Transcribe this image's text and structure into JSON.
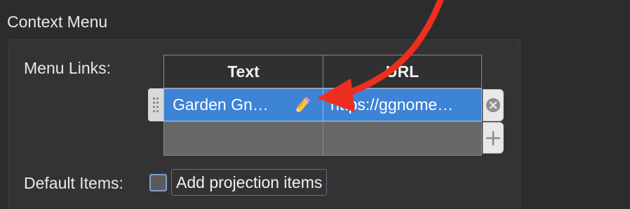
{
  "section": {
    "title": "Context Menu"
  },
  "menu_links": {
    "label": "Menu Links:",
    "columns": [
      "Text",
      "URL"
    ],
    "rows": [
      {
        "text": "Garden Gn…",
        "url": "https://ggnome…",
        "selected": true,
        "editable_icon": "pencil-icon"
      }
    ],
    "remove_icon": "circle-x-icon",
    "add_icon": "plus-icon"
  },
  "default_items": {
    "label": "Default Items:",
    "checkbox_label": "Add projection items",
    "checked": false
  },
  "annotation": {
    "icon": "red-arrow-icon",
    "color": "#ee2e1f"
  },
  "colors": {
    "selection": "#3d83d6",
    "background": "#2c2c2c"
  }
}
